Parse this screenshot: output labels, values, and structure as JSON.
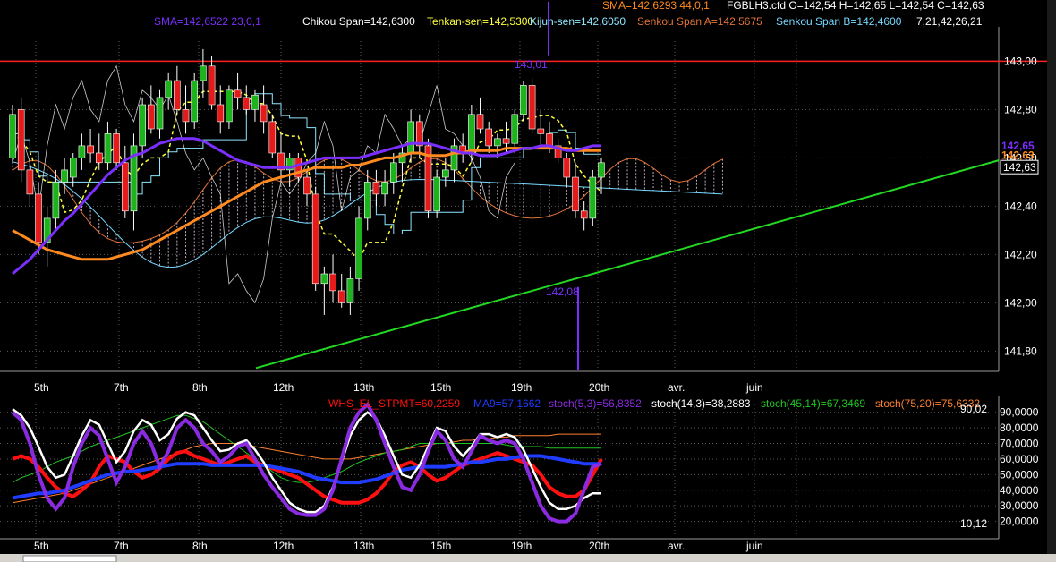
{
  "colors": {
    "background": "#000000",
    "grid": "#5a5a5a",
    "up": "#1db31d",
    "down": "#e31b1b",
    "cloud": "#e6c8e6",
    "sma": "#7b2fff",
    "sma44": "#ff8a1f",
    "tenkan": "#ffff3a",
    "kijun": "#8ee6ff",
    "senkou_a": "#e0733a",
    "senkou_b": "#78d8ff",
    "chikou": "#ffffff",
    "level_line": "#ff2020",
    "trend_line": "#22d822",
    "whs": "#ff1010",
    "ma9": "#1f3cff",
    "stoch53": "#8a2be2",
    "stoch143": "#ffffff",
    "stoch4514": "#22c422",
    "stoch7520": "#ff8030"
  },
  "header": {
    "line1": [
      {
        "text": "SMA=142,6293  44,0,1",
        "color": "#ff8a1f"
      },
      {
        "text": "FGBLH3.cfd O=142,54 H=142,65 L=142,54 C=142,63",
        "color": "#ffffff"
      }
    ],
    "line2": [
      {
        "text": "SMA=142,6522  23,0,1",
        "color": "#7b2fff"
      },
      {
        "text": "Chikou Span=142,6300",
        "color": "#ffffff"
      },
      {
        "text": "Tenkan-sen=142,5300",
        "color": "#ffff3a"
      },
      {
        "text": "Kijun-sen=142,6050",
        "color": "#8ee6ff"
      },
      {
        "text": "Senkou Span A=142,5675",
        "color": "#e0733a"
      },
      {
        "text": "Senkou Span B=142,4600",
        "color": "#78d8ff"
      },
      {
        "text": "7,21,42,26,21",
        "color": "#ffffff"
      }
    ]
  },
  "osc_header": [
    {
      "text": "WHS_EL_STPMT=60,2259",
      "color": "#ff1010"
    },
    {
      "text": "MA9=57,1662",
      "color": "#1f3cff"
    },
    {
      "text": "stoch(5,3)=56,8352",
      "color": "#8a2be2"
    },
    {
      "text": "stoch(14,3)=38,2883",
      "color": "#ffffff"
    },
    {
      "text": "stoch(45,14)=67,3469",
      "color": "#22c422"
    },
    {
      "text": "stoch(75,20)=75,6332",
      "color": "#ff8030"
    }
  ],
  "chart_data": [
    {
      "type": "candlestick",
      "ylim": [
        141.72,
        143.12
      ],
      "yticks": [
        "143,00",
        "142,80",
        "142,60",
        "142,40",
        "142,20",
        "142,00",
        "141,80"
      ],
      "xticks": [
        "5th",
        "7th",
        "8th",
        "12th",
        "13th",
        "15th",
        "19th",
        "20th",
        "avr.",
        "juin"
      ],
      "price_badges": [
        {
          "text": "142,65",
          "value": 142.65,
          "color": "#7b2fff"
        },
        {
          "text": "142,63",
          "value": 142.61,
          "color": "#ff8a1f"
        },
        {
          "text": "142,63",
          "value": 142.56,
          "color": "#000000"
        }
      ],
      "annotations": [
        {
          "text": "143,01",
          "value": 143.01
        },
        {
          "text": "142,08",
          "value": 142.08
        }
      ],
      "level_line": 143.0,
      "trend_line": {
        "from_value": 141.73,
        "to_value": 142.59
      },
      "candles": [
        [
          142.6,
          142.82,
          142.58,
          142.78
        ],
        [
          142.8,
          142.85,
          142.5,
          142.55
        ],
        [
          142.55,
          142.6,
          142.4,
          142.45
        ],
        [
          142.45,
          142.5,
          142.2,
          142.25
        ],
        [
          142.25,
          142.4,
          142.15,
          142.35
        ],
        [
          142.35,
          142.55,
          142.3,
          142.5
        ],
        [
          142.5,
          142.6,
          142.45,
          142.55
        ],
        [
          142.52,
          142.62,
          142.48,
          142.6
        ],
        [
          142.6,
          142.7,
          142.55,
          142.65
        ],
        [
          142.65,
          142.72,
          142.58,
          142.62
        ],
        [
          142.62,
          142.7,
          142.55,
          142.58
        ],
        [
          142.58,
          142.75,
          142.55,
          142.7
        ],
        [
          142.7,
          142.72,
          142.55,
          142.58
        ],
        [
          142.58,
          142.65,
          142.35,
          142.38
        ],
        [
          142.38,
          142.7,
          142.3,
          142.65
        ],
        [
          142.65,
          142.85,
          142.6,
          142.82
        ],
        [
          142.82,
          142.9,
          142.7,
          142.72
        ],
        [
          142.72,
          142.88,
          142.68,
          142.85
        ],
        [
          142.85,
          142.95,
          142.8,
          142.92
        ],
        [
          142.92,
          142.98,
          142.78,
          142.8
        ],
        [
          142.8,
          142.9,
          142.7,
          142.75
        ],
        [
          142.75,
          142.95,
          142.72,
          142.92
        ],
        [
          142.92,
          143.05,
          142.85,
          142.98
        ],
        [
          142.98,
          143.02,
          142.8,
          142.82
        ],
        [
          142.82,
          142.9,
          142.7,
          142.75
        ],
        [
          142.75,
          142.9,
          142.72,
          142.88
        ],
        [
          142.88,
          142.95,
          142.8,
          142.85
        ],
        [
          142.85,
          142.9,
          142.78,
          142.8
        ],
        [
          142.8,
          142.88,
          142.75,
          142.86
        ],
        [
          142.82,
          142.9,
          142.7,
          142.75
        ],
        [
          142.75,
          142.78,
          142.6,
          142.62
        ],
        [
          142.62,
          142.7,
          142.5,
          142.55
        ],
        [
          142.55,
          142.62,
          142.48,
          142.6
        ],
        [
          142.6,
          142.62,
          142.5,
          142.52
        ],
        [
          142.52,
          142.55,
          142.4,
          142.45
        ],
        [
          142.45,
          142.48,
          142.05,
          142.08
        ],
        [
          142.08,
          142.15,
          141.95,
          142.12
        ],
        [
          142.12,
          142.2,
          142.0,
          142.05
        ],
        [
          142.05,
          142.12,
          141.98,
          142.0
        ],
        [
          142.0,
          142.15,
          141.95,
          142.1
        ],
        [
          142.1,
          142.4,
          142.05,
          142.35
        ],
        [
          142.35,
          142.55,
          142.3,
          142.5
        ],
        [
          142.5,
          142.55,
          142.4,
          142.45
        ],
        [
          142.45,
          142.55,
          142.4,
          142.5
        ],
        [
          142.5,
          142.62,
          142.45,
          142.58
        ],
        [
          142.58,
          142.65,
          142.5,
          142.62
        ],
        [
          142.62,
          142.8,
          142.58,
          142.75
        ],
        [
          142.75,
          142.78,
          142.6,
          142.65
        ],
        [
          142.65,
          142.68,
          142.35,
          142.38
        ],
        [
          142.38,
          142.55,
          142.35,
          142.52
        ],
        [
          142.52,
          142.6,
          142.48,
          142.55
        ],
        [
          142.55,
          142.68,
          142.5,
          142.65
        ],
        [
          142.65,
          142.7,
          142.58,
          142.62
        ],
        [
          142.62,
          142.82,
          142.58,
          142.78
        ],
        [
          142.78,
          142.85,
          142.7,
          142.72
        ],
        [
          142.72,
          142.75,
          142.62,
          142.65
        ],
        [
          142.65,
          142.7,
          142.6,
          142.68
        ],
        [
          142.68,
          142.75,
          142.62,
          142.66
        ],
        [
          142.66,
          142.8,
          142.62,
          142.78
        ],
        [
          142.78,
          142.92,
          142.75,
          142.9
        ],
        [
          142.9,
          142.93,
          142.7,
          142.72
        ],
        [
          142.72,
          142.8,
          142.65,
          142.7
        ],
        [
          142.7,
          142.75,
          142.62,
          142.65
        ],
        [
          142.65,
          142.68,
          142.58,
          142.6
        ],
        [
          142.6,
          142.62,
          142.48,
          142.52
        ],
        [
          142.52,
          142.58,
          142.35,
          142.38
        ],
        [
          142.38,
          142.42,
          142.3,
          142.35
        ],
        [
          142.35,
          142.55,
          142.32,
          142.52
        ],
        [
          142.52,
          142.6,
          142.45,
          142.58
        ]
      ],
      "sma23": [
        142.12,
        142.15,
        142.18,
        142.22,
        142.26,
        142.3,
        142.34,
        142.37,
        142.41,
        142.45,
        142.49,
        142.53,
        142.56,
        142.59,
        142.61,
        142.62,
        142.64,
        142.66,
        142.67,
        142.68,
        142.68,
        142.68,
        142.67,
        142.65,
        142.63,
        142.61,
        142.59,
        142.58,
        142.57,
        142.56,
        142.56,
        142.56,
        142.56,
        142.57,
        142.58,
        142.59,
        142.6,
        142.6,
        142.6,
        142.6,
        142.6,
        142.61,
        142.62,
        142.63,
        142.64,
        142.65,
        142.66,
        142.66,
        142.66,
        142.65,
        142.64,
        142.63,
        142.62,
        142.62,
        142.61,
        142.61,
        142.61,
        142.62,
        142.63,
        142.64,
        142.64,
        142.65,
        142.65,
        142.64,
        142.63,
        142.63,
        142.64,
        142.65,
        142.65
      ],
      "sma44": [
        142.3,
        142.28,
        142.26,
        142.24,
        142.22,
        142.21,
        142.2,
        142.19,
        142.18,
        142.18,
        142.18,
        142.18,
        142.19,
        142.2,
        142.21,
        142.22,
        142.24,
        142.26,
        142.28,
        142.3,
        142.32,
        142.34,
        142.36,
        142.38,
        142.4,
        142.42,
        142.44,
        142.46,
        142.48,
        142.5,
        142.51,
        142.52,
        142.53,
        142.54,
        142.55,
        142.56,
        142.56,
        142.56,
        142.56,
        142.57,
        142.57,
        142.58,
        142.59,
        142.6,
        142.6,
        142.61,
        142.62,
        142.62,
        142.61,
        142.61,
        142.61,
        142.62,
        142.62,
        142.63,
        142.63,
        142.63,
        142.63,
        142.64,
        142.64,
        142.64,
        142.64,
        142.64,
        142.64,
        142.64,
        142.64,
        142.63,
        142.63,
        142.63,
        142.63
      ],
      "osc_ylim": [
        10,
        95
      ],
      "osc_ticks": [
        "90,0000",
        "80,0000",
        "70,0000",
        "60,0000",
        "50,0000",
        "40,0000",
        "30,0000",
        "20,0000"
      ],
      "osc_labels": {
        "max": "90,02",
        "min": "10,12"
      },
      "whs": [
        60,
        62,
        60,
        55,
        48,
        42,
        38,
        36,
        40,
        45,
        55,
        62,
        60,
        58,
        52,
        48,
        50,
        54,
        60,
        64,
        65,
        62,
        60,
        58,
        56,
        58,
        60,
        62,
        58,
        56,
        54,
        52,
        50,
        48,
        44,
        40,
        36,
        34,
        32,
        32,
        32,
        34,
        38,
        44,
        52,
        56,
        58,
        55,
        50,
        46,
        48,
        52,
        56,
        58,
        60,
        62,
        64,
        62,
        60,
        58,
        56,
        50,
        42,
        38,
        36,
        36,
        40,
        50,
        60
      ],
      "ma9": [
        35,
        36,
        37,
        38,
        38,
        39,
        40,
        42,
        44,
        46,
        48,
        50,
        51,
        52,
        52,
        53,
        54,
        55,
        56,
        57,
        57,
        57,
        57,
        56,
        56,
        56,
        56,
        56,
        56,
        56,
        55,
        54,
        53,
        52,
        50,
        48,
        47,
        46,
        45,
        45,
        45,
        46,
        47,
        49,
        51,
        53,
        54,
        55,
        55,
        55,
        55,
        56,
        57,
        58,
        58,
        59,
        60,
        60,
        61,
        62,
        62,
        62,
        61,
        60,
        59,
        58,
        57,
        57,
        57
      ],
      "stoch53": [
        90,
        85,
        70,
        50,
        35,
        28,
        35,
        55,
        70,
        80,
        75,
        60,
        45,
        55,
        70,
        78,
        70,
        55,
        65,
        80,
        85,
        80,
        70,
        65,
        58,
        62,
        68,
        70,
        60,
        50,
        42,
        35,
        28,
        25,
        24,
        24,
        28,
        40,
        60,
        80,
        90,
        95,
        85,
        70,
        55,
        42,
        40,
        50,
        65,
        78,
        72,
        60,
        55,
        65,
        75,
        72,
        70,
        72,
        70,
        60,
        45,
        30,
        22,
        20,
        20,
        25,
        40,
        55,
        57
      ],
      "stoch143": [
        92,
        88,
        80,
        68,
        55,
        48,
        50,
        62,
        75,
        85,
        82,
        70,
        58,
        65,
        78,
        85,
        82,
        72,
        76,
        86,
        90,
        88,
        80,
        72,
        65,
        66,
        70,
        72,
        66,
        58,
        48,
        40,
        32,
        28,
        26,
        26,
        30,
        42,
        58,
        75,
        85,
        90,
        86,
        75,
        62,
        50,
        48,
        56,
        68,
        80,
        78,
        68,
        62,
        68,
        76,
        76,
        74,
        76,
        74,
        66,
        54,
        42,
        32,
        28,
        28,
        30,
        35,
        38,
        38
      ],
      "stoch4514": [
        45,
        48,
        50,
        52,
        55,
        58,
        60,
        62,
        65,
        68,
        70,
        72,
        74,
        76,
        78,
        80,
        82,
        84,
        86,
        88,
        88,
        86,
        84,
        80,
        76,
        72,
        68,
        64,
        60,
        56,
        52,
        48,
        46,
        45,
        45,
        46,
        48,
        50,
        52,
        55,
        58,
        60,
        62,
        64,
        65,
        66,
        68,
        70,
        70,
        70,
        70,
        70,
        70,
        70,
        70,
        70,
        70,
        69,
        68,
        68,
        68,
        68,
        67,
        67,
        67,
        67,
        67,
        67,
        67
      ],
      "stoch7520": [
        32,
        33,
        34,
        35,
        36,
        37,
        38,
        40,
        42,
        44,
        46,
        48,
        50,
        52,
        54,
        56,
        58,
        60,
        62,
        64,
        66,
        68,
        69,
        70,
        70,
        70,
        70,
        69,
        68,
        67,
        66,
        65,
        64,
        63,
        62,
        61,
        60,
        60,
        60,
        60,
        61,
        62,
        63,
        64,
        65,
        66,
        67,
        68,
        69,
        70,
        70,
        71,
        72,
        72,
        73,
        73,
        74,
        74,
        75,
        75,
        75,
        75,
        75,
        76,
        76,
        76,
        76,
        76,
        76
      ]
    }
  ]
}
